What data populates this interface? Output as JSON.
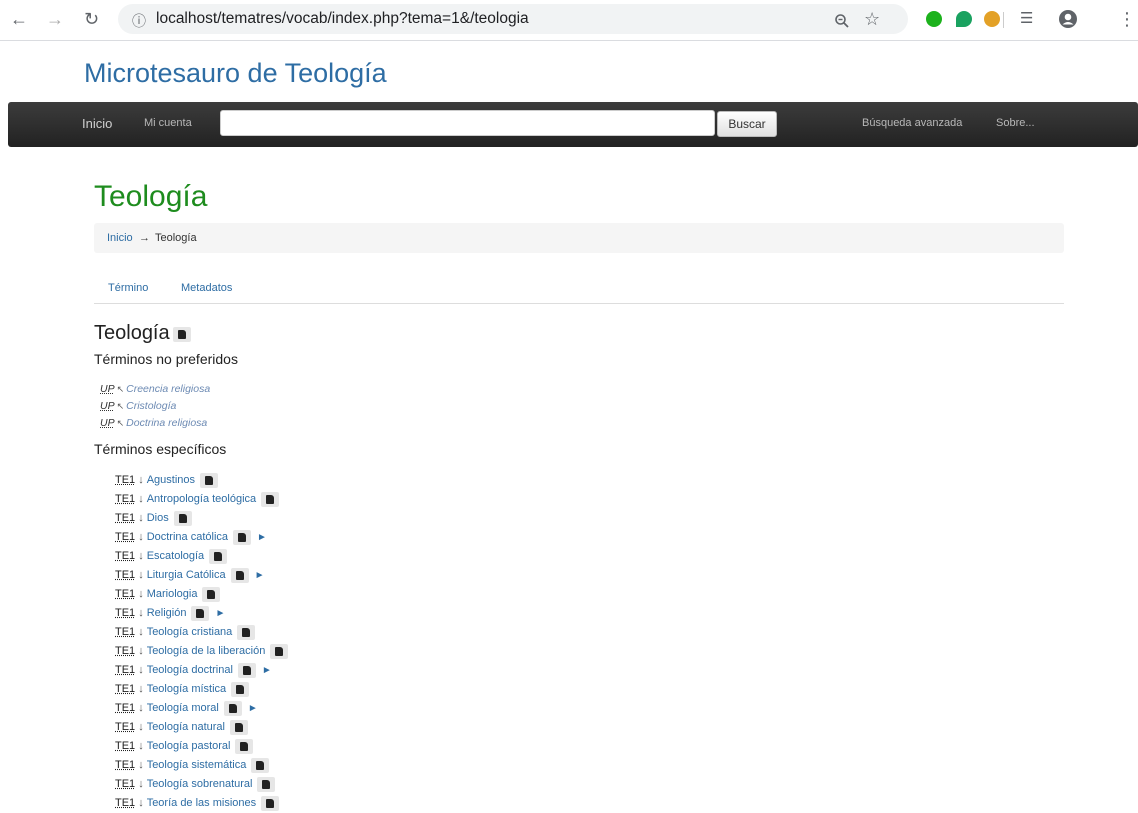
{
  "browser": {
    "url": "localhost/tematres/vocab/index.php?tema=1&/teologia",
    "info_icon": "info-icon",
    "back_icon": "back-arrow-icon",
    "forward_icon": "forward-arrow-icon",
    "reload_icon": "reload-icon",
    "zoom_icon": "zoom-icon",
    "star_icon": "star-icon",
    "extension_colors": [
      "#1db21d",
      "#1aa260",
      "#e3a127"
    ],
    "menu_icon": "kebab-menu-icon"
  },
  "site": {
    "title": "Microtesauro de Teología",
    "title_color": "#2e6da4"
  },
  "navbar": {
    "home": "Inicio",
    "account": "Mi cuenta",
    "search_placeholder": "",
    "search_button": "Buscar",
    "advanced": "Búsqueda avanzada",
    "about": "Sobre..."
  },
  "main": {
    "title": "Teología",
    "title_color": "#1e8c1e",
    "breadcrumb": {
      "root": "Inicio",
      "separator": "→",
      "current": "Teología"
    },
    "tabs": [
      {
        "label": "Término"
      },
      {
        "label": "Metadatos"
      }
    ],
    "term_heading": "Teología",
    "non_preferred": {
      "heading": "Términos no preferidos",
      "abbr": "UP",
      "arrow": "↖",
      "items": [
        "Creencia religiosa",
        "Cristología",
        "Doctrina religiosa"
      ]
    },
    "specific": {
      "heading": "Términos específicos",
      "abbr": "TE1",
      "arrow": "↓",
      "expand_symbol": "►",
      "items": [
        {
          "label": "Agustinos",
          "has_children": false
        },
        {
          "label": "Antropología teológica",
          "has_children": false
        },
        {
          "label": "Dios",
          "has_children": false
        },
        {
          "label": "Doctrina católica",
          "has_children": true
        },
        {
          "label": "Escatología",
          "has_children": false
        },
        {
          "label": "Liturgia Católica",
          "has_children": true
        },
        {
          "label": "Mariologia",
          "has_children": false
        },
        {
          "label": "Religión",
          "has_children": true
        },
        {
          "label": "Teología cristiana",
          "has_children": false
        },
        {
          "label": "Teología de la liberación",
          "has_children": false
        },
        {
          "label": "Teología doctrinal",
          "has_children": true
        },
        {
          "label": "Teología mística",
          "has_children": false
        },
        {
          "label": "Teología moral",
          "has_children": true
        },
        {
          "label": "Teología natural",
          "has_children": false
        },
        {
          "label": "Teología pastoral",
          "has_children": false
        },
        {
          "label": "Teología sistemática",
          "has_children": false
        },
        {
          "label": "Teología sobrenatural",
          "has_children": false
        },
        {
          "label": "Teoría de las misiones",
          "has_children": false
        }
      ]
    }
  }
}
